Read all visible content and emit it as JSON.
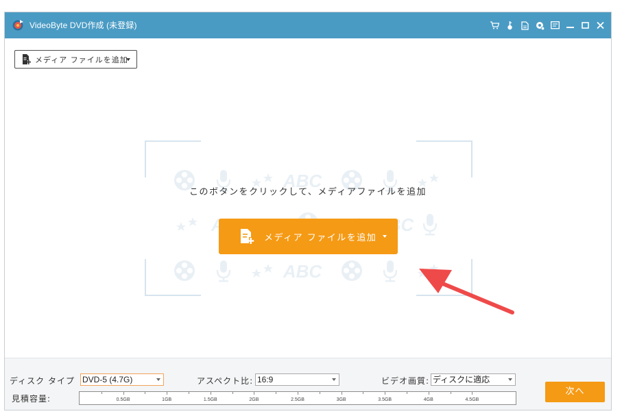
{
  "window": {
    "title": "VideoByte DVD作成 (未登録)"
  },
  "titlebar_icons": [
    "cart-icon",
    "key-icon",
    "document-icon",
    "feedback-icon",
    "menu-icon",
    "minimize-icon",
    "maximize-icon",
    "close-icon"
  ],
  "toolbar": {
    "add_media_label": "メディア ファイルを追加"
  },
  "main": {
    "hint": "このボタンをクリックして、メディアファイルを追加",
    "add_media_label": "メディア ファイルを追加",
    "watermark_text": "ABC"
  },
  "bottom": {
    "disc_type_label": "ディスク タイプ",
    "disc_type_value": "DVD-5 (4.7G)",
    "aspect_label": "アスペクト比:",
    "aspect_value": "16:9",
    "quality_label": "ビデオ画質:",
    "quality_value": "ディスクに適応",
    "capacity_label": "見積容量:",
    "capacity_ticks": [
      {
        "label": "0.5GB",
        "pos": 0.1
      },
      {
        "label": "1GB",
        "pos": 0.2
      },
      {
        "label": "1.5GB",
        "pos": 0.3
      },
      {
        "label": "2GB",
        "pos": 0.4
      },
      {
        "label": "2.5GB",
        "pos": 0.5
      },
      {
        "label": "3GB",
        "pos": 0.6
      },
      {
        "label": "3.5GB",
        "pos": 0.7
      },
      {
        "label": "4GB",
        "pos": 0.8
      },
      {
        "label": "4.5GB",
        "pos": 0.9
      }
    ],
    "next_label": "次へ"
  },
  "colors": {
    "titlebar": "#4a9bc4",
    "accent": "#f59a14",
    "arrow": "#ef4a4a",
    "watermark": "#e9f0f5"
  }
}
